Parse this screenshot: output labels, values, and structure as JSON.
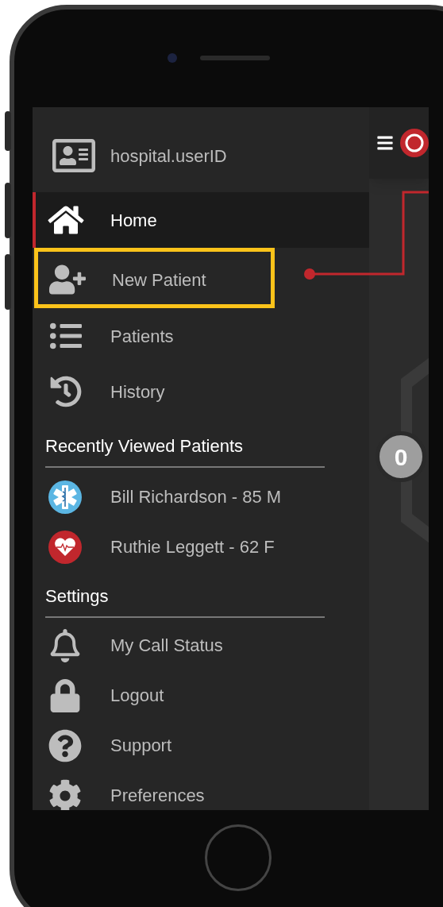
{
  "user": {
    "name": "hospital.userID"
  },
  "nav": [
    {
      "label": "Home",
      "selected": true,
      "highlighted": false
    },
    {
      "label": "New Patient",
      "selected": false,
      "highlighted": true
    },
    {
      "label": "Patients",
      "selected": false,
      "highlighted": false
    },
    {
      "label": "History",
      "selected": false,
      "highlighted": false
    }
  ],
  "recent": {
    "title": "Recently Viewed Patients",
    "items": [
      {
        "label": "Bill Richardson - 85 M",
        "kind": "ems"
      },
      {
        "label": "Ruthie Leggett - 62 F",
        "kind": "cardiac"
      }
    ]
  },
  "settings": {
    "title": "Settings",
    "items": [
      {
        "label": "My Call Status"
      },
      {
        "label": "Logout"
      },
      {
        "label": "Support"
      },
      {
        "label": "Preferences"
      }
    ]
  },
  "badge": {
    "count": "0"
  }
}
